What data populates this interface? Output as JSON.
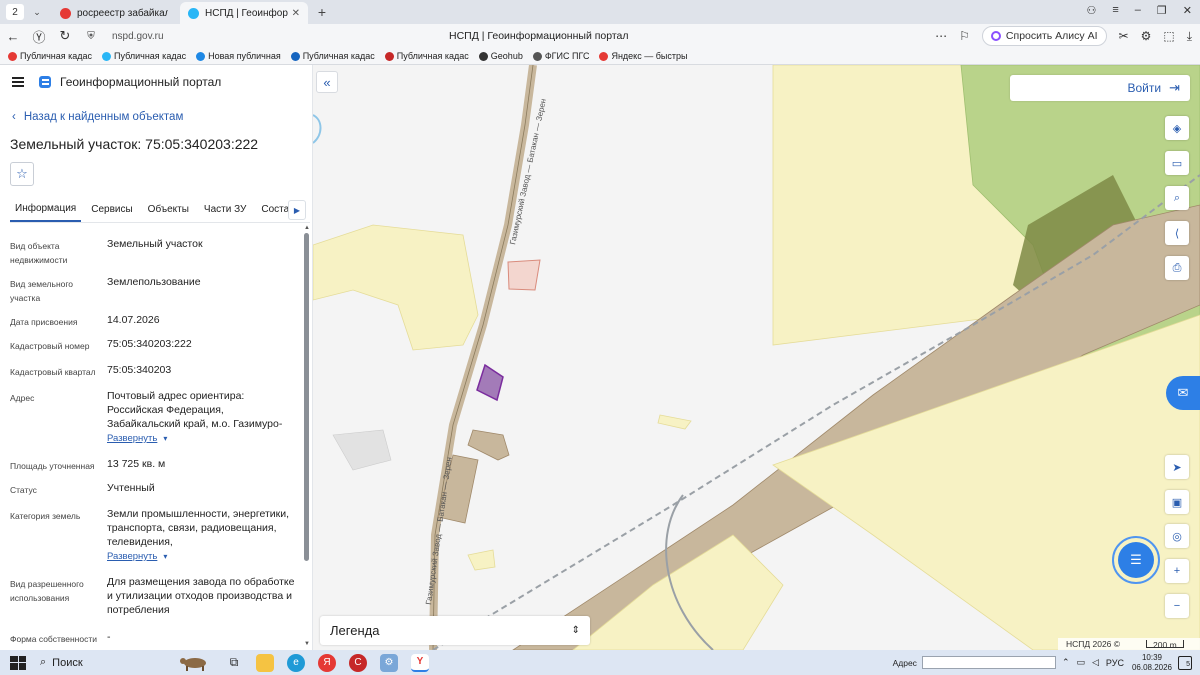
{
  "browser": {
    "tab_count": "2",
    "tabs": [
      {
        "title": "росреестр забайкальский",
        "favicon_color": "#e53935"
      },
      {
        "title": "НСПД | Геоинформацио",
        "favicon_color": "#29b6f6"
      }
    ],
    "url": "nspd.gov.ru",
    "page_title": "НСПД | Геоинформационный портал",
    "alisa_label": "Спросить Алису AI",
    "bookmarks": [
      {
        "label": "Публичная кадас",
        "color": "#e53935"
      },
      {
        "label": "Публичная кадас",
        "color": "#29b6f6"
      },
      {
        "label": "Новая публичная",
        "color": "#1e88e5"
      },
      {
        "label": "Публичная кадас",
        "color": "#1565c0"
      },
      {
        "label": "Публичная кадас",
        "color": "#c62828"
      },
      {
        "label": "Geohub",
        "color": "#333333"
      },
      {
        "label": "ФГИС ПГС",
        "color": "#555555"
      },
      {
        "label": "Яндекс — быстры",
        "color": "#e53935"
      }
    ]
  },
  "panel": {
    "portal_name": "Геоинформационный портал",
    "back_link": "Назад к найденным объектам",
    "object_title": "Земельный участок: 75:05:340203:222",
    "tabs": [
      "Информация",
      "Сервисы",
      "Объекты",
      "Части ЗУ",
      "Состав"
    ],
    "expand_label": "Развернуть",
    "rows": [
      {
        "label": "Вид объекта недвижимости",
        "value": "Земельный участок"
      },
      {
        "label": "Вид земельного участка",
        "value": "Землепользование"
      },
      {
        "label": "Дата присвоения",
        "value": "14.07.2026"
      },
      {
        "label": "Кадастровый номер",
        "value": "75:05:340203:222"
      },
      {
        "label": "Кадастровый квартал",
        "value": "75:05:340203"
      },
      {
        "label": "Адрес",
        "value": "Почтовый адрес ориентира: Российская Федерация, Забайкальский край, м.о. Газимуро-"
      },
      {
        "label": "Площадь уточненная",
        "value": "13 725 кв. м"
      },
      {
        "label": "Статус",
        "value": "Учтенный"
      },
      {
        "label": "Категория земель",
        "value": "Земли промышленности, энергетики, транспорта, связи, радиовещания, телевидения,"
      },
      {
        "label": "Вид разрешенного использования",
        "value": "Для размещения завода по обработке и утилизации отходов производства и потребления"
      },
      {
        "label": "Форма собственности",
        "value": "-"
      }
    ]
  },
  "map": {
    "login_label": "Войти",
    "legend_label": "Легенда",
    "copyright": "НСПД 2026 ©",
    "scale_label": "200 m",
    "road_label_1": "Газимурский Завод — Батакан — Зерен",
    "road_label_2": "Газимурский Завод — Батакан — Зерен",
    "colors": {
      "background": "#f4f4f4",
      "zone_yellow": "#f7f2c4",
      "parcel_tan": "#c8b79c",
      "forest_green": "#b9d38a",
      "dark_olive": "#7e8a45",
      "selected_purple": "#a37bb8",
      "accent_blue": "#2d7fe6"
    }
  },
  "taskbar": {
    "search_label": "Поиск",
    "address_label": "Адрес",
    "lang": "РУС",
    "time": "10:39",
    "date": "06.08.2026",
    "notif_count": "5"
  }
}
